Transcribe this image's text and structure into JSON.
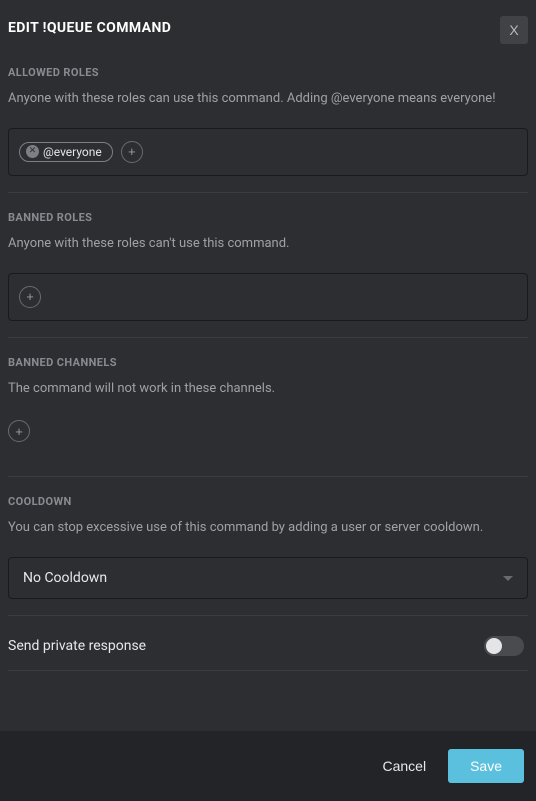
{
  "header": {
    "title": "EDIT !QUEUE COMMAND",
    "close": "X"
  },
  "allowed_roles": {
    "label": "ALLOWED ROLES",
    "desc": "Anyone with these roles can use this command. Adding @everyone means everyone!",
    "chips": [
      {
        "label": "@everyone"
      }
    ]
  },
  "banned_roles": {
    "label": "BANNED ROLES",
    "desc": "Anyone with these roles can't use this command."
  },
  "banned_channels": {
    "label": "BANNED CHANNELS",
    "desc": "The command will not work in these channels."
  },
  "cooldown": {
    "label": "COOLDOWN",
    "desc": "You can stop excessive use of this command by adding a user or server cooldown.",
    "selected": "No Cooldown"
  },
  "private_response": {
    "label": "Send private response"
  },
  "footer": {
    "cancel": "Cancel",
    "save": "Save"
  },
  "icons": {
    "plus": "+",
    "x": "✕"
  }
}
